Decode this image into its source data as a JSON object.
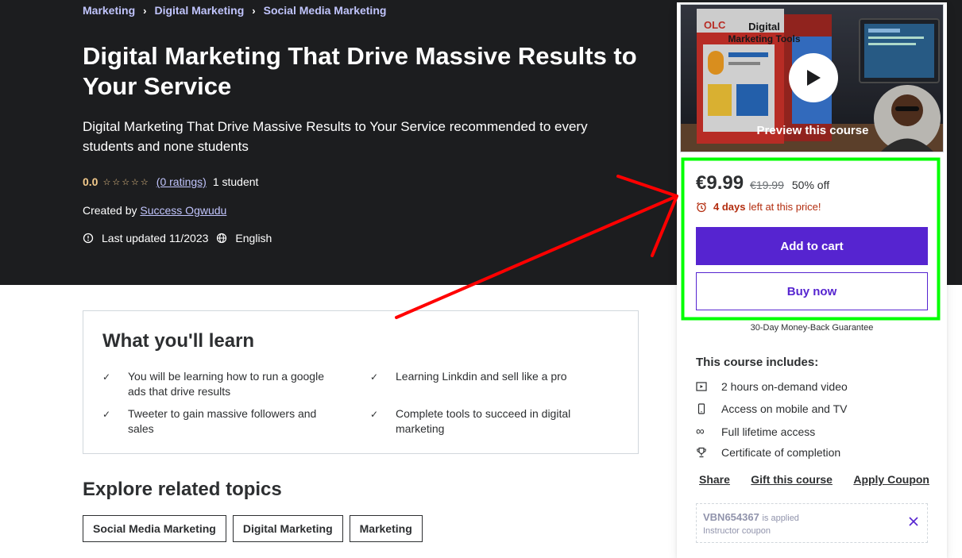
{
  "breadcrumb": [
    "Marketing",
    "Digital Marketing",
    "Social Media Marketing"
  ],
  "course": {
    "title": "Digital Marketing That Drive Massive Results to Your Service",
    "headline": "Digital Marketing That Drive Massive Results to Your Service recommended to every students and none students",
    "rating": "0.0",
    "ratings_link": "(0 ratings)",
    "students": "1 student",
    "created_by_label": "Created by",
    "instructor": "Success Ogwudu",
    "last_updated": "Last updated 11/2023",
    "language": "English"
  },
  "learn": {
    "title": "What you'll learn",
    "items": [
      "You will be learning how to run a google ads that drive results",
      "Learning Linkdin and sell like a pro",
      "Tweeter to gain massive followers and sales",
      "Complete tools to succeed in digital marketing"
    ]
  },
  "related": {
    "title": "Explore related topics",
    "topics": [
      "Social Media Marketing",
      "Digital Marketing",
      "Marketing"
    ]
  },
  "sidebar": {
    "preview_label": "Preview this course",
    "preview_box_text_1": "Digital",
    "preview_box_text_2": "Marketing Tools",
    "preview_logo": "OLC",
    "price": "€9.99",
    "old_price": "€19.99",
    "discount": "50% off",
    "time_bold": "4 days",
    "time_rest": "left at this price!",
    "add_to_cart": "Add to cart",
    "buy_now": "Buy now",
    "guarantee": "30-Day Money-Back Guarantee",
    "includes_title": "This course includes:",
    "includes": [
      {
        "icon": "video-icon",
        "label": "2 hours on-demand video"
      },
      {
        "icon": "mobile-icon",
        "label": "Access on mobile and TV"
      },
      {
        "icon": "infinity-icon",
        "label": "Full lifetime access"
      },
      {
        "icon": "trophy-icon",
        "label": "Certificate of completion"
      }
    ],
    "links": [
      "Share",
      "Gift this course",
      "Apply Coupon"
    ],
    "coupon_code": "VBN654367",
    "coupon_applied": "is applied",
    "coupon_type": "Instructor coupon"
  },
  "colors": {
    "hero_bg": "#1c1d1f",
    "accent_purple": "#5624d0",
    "link_lavender": "#c0c4fc",
    "star_gold": "#f3ca8c",
    "urgency_red": "#b32d0f",
    "annotation_red": "#ff0000",
    "highlight_green": "#00ff00"
  }
}
